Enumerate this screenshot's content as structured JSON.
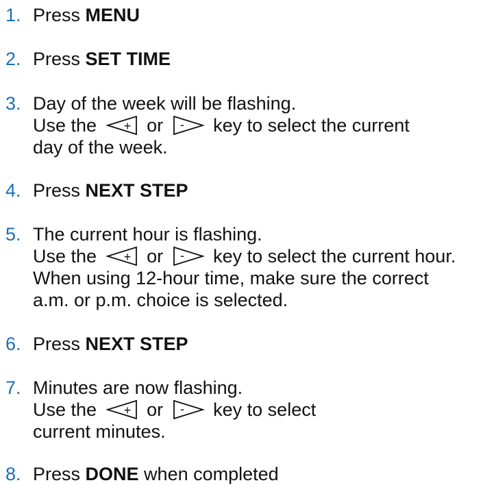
{
  "steps": [
    {
      "num": "1.",
      "lines": [
        {
          "pre": "Press ",
          "bold": "MENU"
        }
      ]
    },
    {
      "num": "2.",
      "lines": [
        {
          "pre": "Press ",
          "bold": "SET TIME"
        }
      ]
    },
    {
      "num": "3.",
      "lines": [
        {
          "text": "Day of the week will be flashing."
        },
        {
          "pre": "Use the",
          "mid": "or",
          "post": "key to select the current"
        },
        {
          "text": "day of the week."
        }
      ]
    },
    {
      "num": "4.",
      "lines": [
        {
          "pre": "Press ",
          "bold": "NEXT STEP"
        }
      ]
    },
    {
      "num": "5.",
      "lines": [
        {
          "text": "The current hour is flashing."
        },
        {
          "pre": "Use the",
          "mid": "or",
          "post": "key to select the current hour."
        },
        {
          "text": "When using 12-hour time, make sure the correct"
        },
        {
          "text": "a.m. or p.m. choice is selected."
        }
      ]
    },
    {
      "num": "6.",
      "lines": [
        {
          "pre": "Press ",
          "bold": "NEXT STEP"
        }
      ]
    },
    {
      "num": "7.",
      "lines": [
        {
          "text": "Minutes are now flashing."
        },
        {
          "pre": "Use the",
          "mid": "or",
          "post": "key to select"
        },
        {
          "text": "current minutes."
        }
      ]
    },
    {
      "num": "8.",
      "lines": [
        {
          "pre": "Press ",
          "bold": "DONE",
          "post2": " when completed"
        }
      ]
    }
  ],
  "keys": {
    "plus_icon": "+",
    "minus_icon": "-"
  },
  "colors": {
    "step_number": "#1a6fb5",
    "text": "#111111"
  }
}
